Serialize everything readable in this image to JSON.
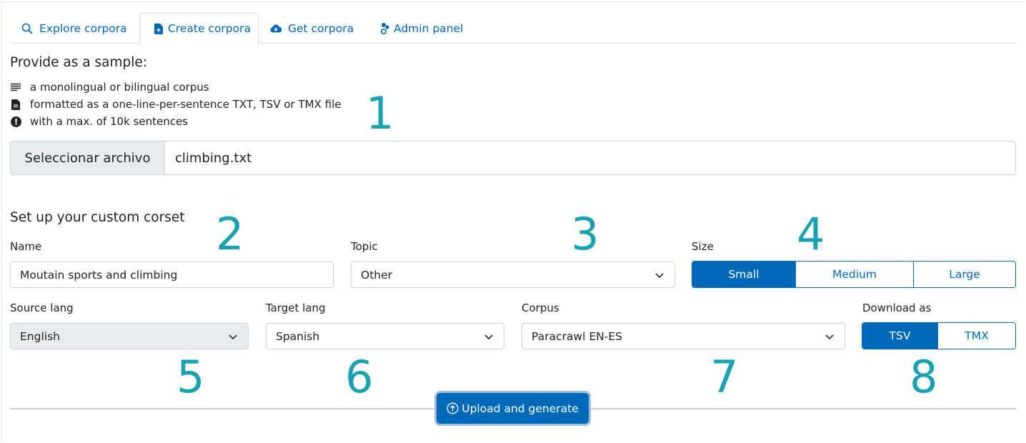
{
  "tabs": [
    {
      "label": "Explore corpora",
      "icon": "search-icon"
    },
    {
      "label": "Create corpora",
      "icon": "file-plus-icon"
    },
    {
      "label": "Get corpora",
      "icon": "cloud-download-icon"
    },
    {
      "label": "Admin panel",
      "icon": "users-cog-icon"
    }
  ],
  "sample": {
    "title": "Provide as a sample:",
    "items": [
      {
        "text": "a monolingual or bilingual corpus",
        "icon": "lines-icon"
      },
      {
        "text": "formatted as a one-line-per-sentence TXT, TSV or TMX file",
        "icon": "document-icon"
      },
      {
        "text": "with a max. of 10k sentences",
        "icon": "alert-circle-icon"
      }
    ]
  },
  "file_input": {
    "button_label": "Seleccionar archivo",
    "file_name": "climbing.txt"
  },
  "setup": {
    "title": "Set up your custom corset",
    "name_label": "Name",
    "name_value": "Moutain sports and climbing",
    "topic_label": "Topic",
    "topic_value": "Other",
    "size_label": "Size",
    "size_options": [
      "Small",
      "Medium",
      "Large"
    ],
    "size_selected": "Small",
    "source_label": "Source lang",
    "source_value": "English",
    "target_label": "Target lang",
    "target_value": "Spanish",
    "corpus_label": "Corpus",
    "corpus_value": "Paracrawl EN-ES",
    "download_label": "Download as",
    "download_options": [
      "TSV",
      "TMX"
    ],
    "download_selected": "TSV"
  },
  "upload_label": "Upload and generate",
  "callouts": [
    "1",
    "2",
    "3",
    "4",
    "5",
    "6",
    "7",
    "8"
  ],
  "colors": {
    "primary": "#0069b8",
    "callout": "#17a2b2",
    "disabled_bg": "#e9ecef"
  }
}
